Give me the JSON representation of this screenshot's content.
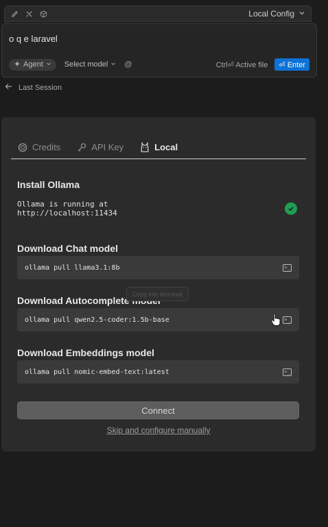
{
  "topbar": {
    "icons": [
      "pencil-icon",
      "tools-icon",
      "cube-icon"
    ],
    "config_label": "Local Config"
  },
  "input": {
    "query": "o q e laravel",
    "agent_label": "Agent",
    "model_label": "Select model",
    "at_label": "@",
    "ctrl_label": "Ctrl⏎ Active file",
    "enter_label": "⏎ Enter"
  },
  "last_session": "Last Session",
  "tabs": [
    {
      "label": "Credits",
      "icon": "credits-icon"
    },
    {
      "label": "API Key",
      "icon": "key-icon"
    },
    {
      "label": "Local",
      "icon": "ollama-icon"
    }
  ],
  "install": {
    "title": "Install Ollama",
    "status": "Ollama is running at\nhttp://localhost:11434"
  },
  "chat": {
    "title": "Download Chat model",
    "command": "ollama pull llama3.1:8b"
  },
  "autocomplete": {
    "title": "Download Autocomplete model",
    "command": "ollama pull qwen2.5-coder:1.5b-base"
  },
  "embeddings": {
    "title": "Download Embeddings model",
    "command": "ollama pull nomic-embed-text:latest"
  },
  "tooltip": "Copy into terminal",
  "connect_label": "Connect",
  "skip_label": "Skip and configure manually",
  "colors": {
    "accent": "#0e72d6",
    "success": "#1f9d55"
  }
}
